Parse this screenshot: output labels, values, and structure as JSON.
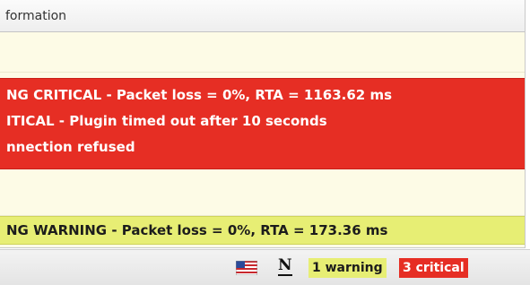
{
  "table": {
    "column_header": "formation",
    "rows": [
      {
        "status": "ok",
        "lines": []
      },
      {
        "status": "critical",
        "lines": [
          "NG CRITICAL - Packet loss = 0%, RTA = 1163.62 ms",
          "ITICAL - Plugin timed out after 10 seconds",
          "nnection refused"
        ]
      },
      {
        "status": "ok",
        "lines": []
      },
      {
        "status": "warning",
        "lines": [
          "NG WARNING - Packet loss = 0%, RTA = 173.36 ms"
        ]
      }
    ]
  },
  "statusbar": {
    "flag_icon": "us-flag-icon",
    "n_icon_label": "N",
    "warning_badge": "1 warning",
    "critical_badge": "3 critical"
  },
  "colors": {
    "critical": "#e62e24",
    "warning": "#e7ee74",
    "ok_background": "#fdfbe6"
  }
}
